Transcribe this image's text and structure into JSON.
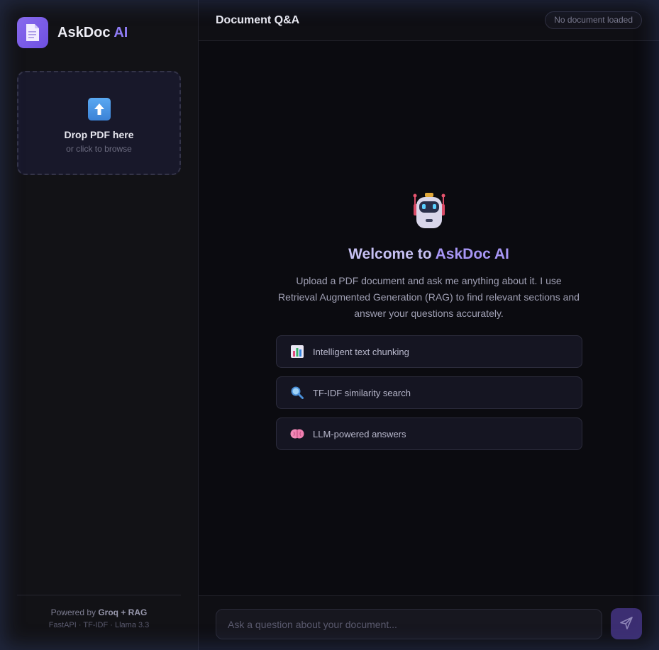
{
  "sidebar": {
    "brand": {
      "name": "AskDoc",
      "accent": "AI",
      "logo_icon": "document-icon"
    },
    "dropzone": {
      "icon": "upload-arrow-icon",
      "title": "Drop PDF here",
      "subtitle": "or click to browse"
    },
    "footer": {
      "powered_prefix": "Powered by",
      "powered_strong": "Groq + RAG",
      "stack": "FastAPI · TF-IDF · Llama 3.3"
    }
  },
  "header": {
    "title": "Document Q&A",
    "status": "No document loaded"
  },
  "welcome": {
    "icon": "robot-icon",
    "title_prefix": "Welcome to",
    "title_accent": "AskDoc AI",
    "description": "Upload a PDF document and ask me anything about it. I use Retrieval Augmented Generation (RAG) to find relevant sections and answer your questions accurately."
  },
  "features": [
    {
      "icon": "bar-chart-icon",
      "label": "Intelligent text chunking"
    },
    {
      "icon": "magnifier-icon",
      "label": "TF-IDF similarity search"
    },
    {
      "icon": "brain-icon",
      "label": "LLM-powered answers"
    }
  ],
  "input": {
    "placeholder": "Ask a question about your document...",
    "send_icon": "send-icon"
  },
  "colors": {
    "accent": "#8f7cf5",
    "background": "#0b0b10",
    "sidebar": "#121216",
    "send_button": "#3c2e72"
  }
}
